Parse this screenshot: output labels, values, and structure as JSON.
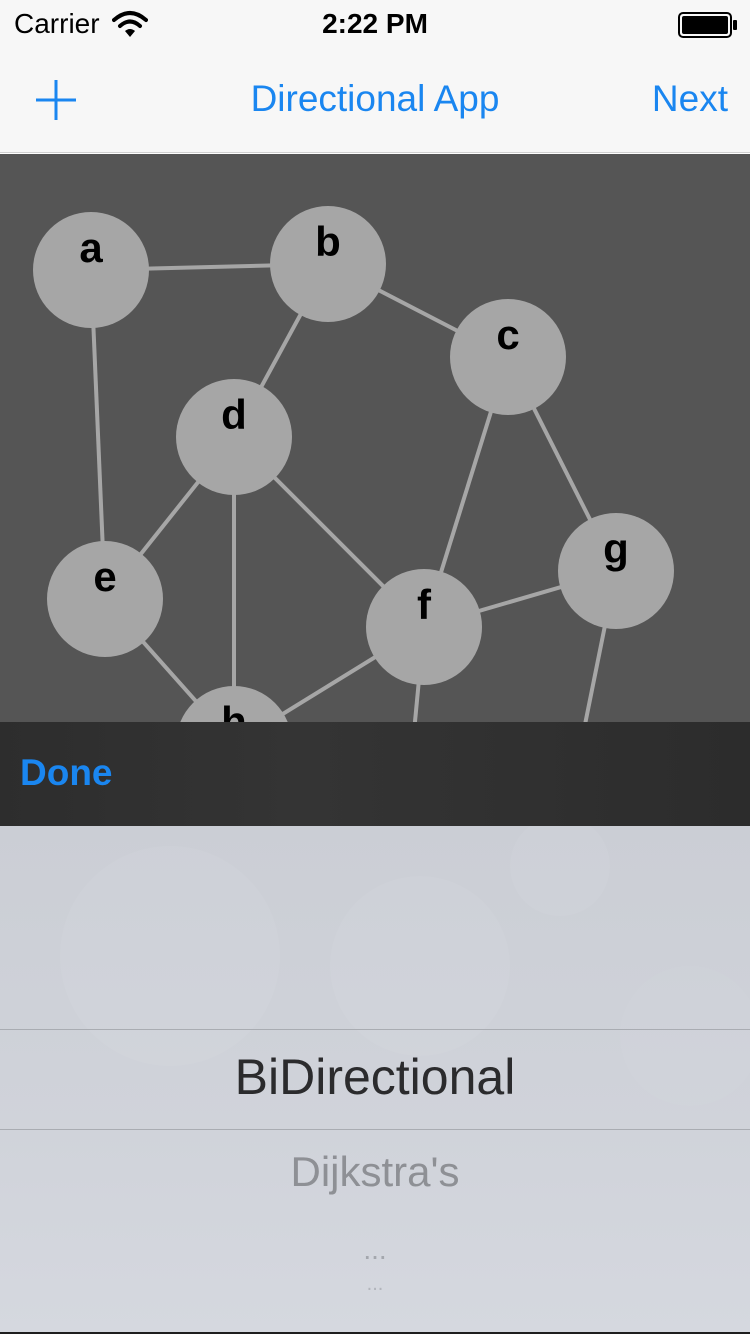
{
  "status_bar": {
    "carrier": "Carrier",
    "time": "2:22 PM",
    "wifi_icon": "wifi-icon",
    "battery_icon": "battery-icon"
  },
  "nav_bar": {
    "add_icon": "plus-icon",
    "title": "Directional App",
    "next_label": "Next",
    "accent_color": "#1a86f0"
  },
  "graph": {
    "background_color": "#555555",
    "node_color": "#a6a6a6",
    "edge_color": "#a6a6a6",
    "nodes": [
      {
        "id": "a",
        "label": "a"
      },
      {
        "id": "b",
        "label": "b"
      },
      {
        "id": "c",
        "label": "c"
      },
      {
        "id": "d",
        "label": "d"
      },
      {
        "id": "e",
        "label": "e"
      },
      {
        "id": "f",
        "label": "f"
      },
      {
        "id": "g",
        "label": "g"
      },
      {
        "id": "h",
        "label": "h"
      }
    ],
    "edges": [
      [
        "a",
        "b"
      ],
      [
        "a",
        "e"
      ],
      [
        "b",
        "d"
      ],
      [
        "b",
        "c"
      ],
      [
        "c",
        "f"
      ],
      [
        "c",
        "g"
      ],
      [
        "d",
        "e"
      ],
      [
        "d",
        "h"
      ],
      [
        "d",
        "f"
      ],
      [
        "e",
        "h"
      ],
      [
        "f",
        "h"
      ],
      [
        "f",
        "g"
      ]
    ]
  },
  "toolbar": {
    "done_label": "Done"
  },
  "picker": {
    "selected": "BiDirectional",
    "options": [
      "Dijkstra's",
      "...",
      "..."
    ]
  }
}
